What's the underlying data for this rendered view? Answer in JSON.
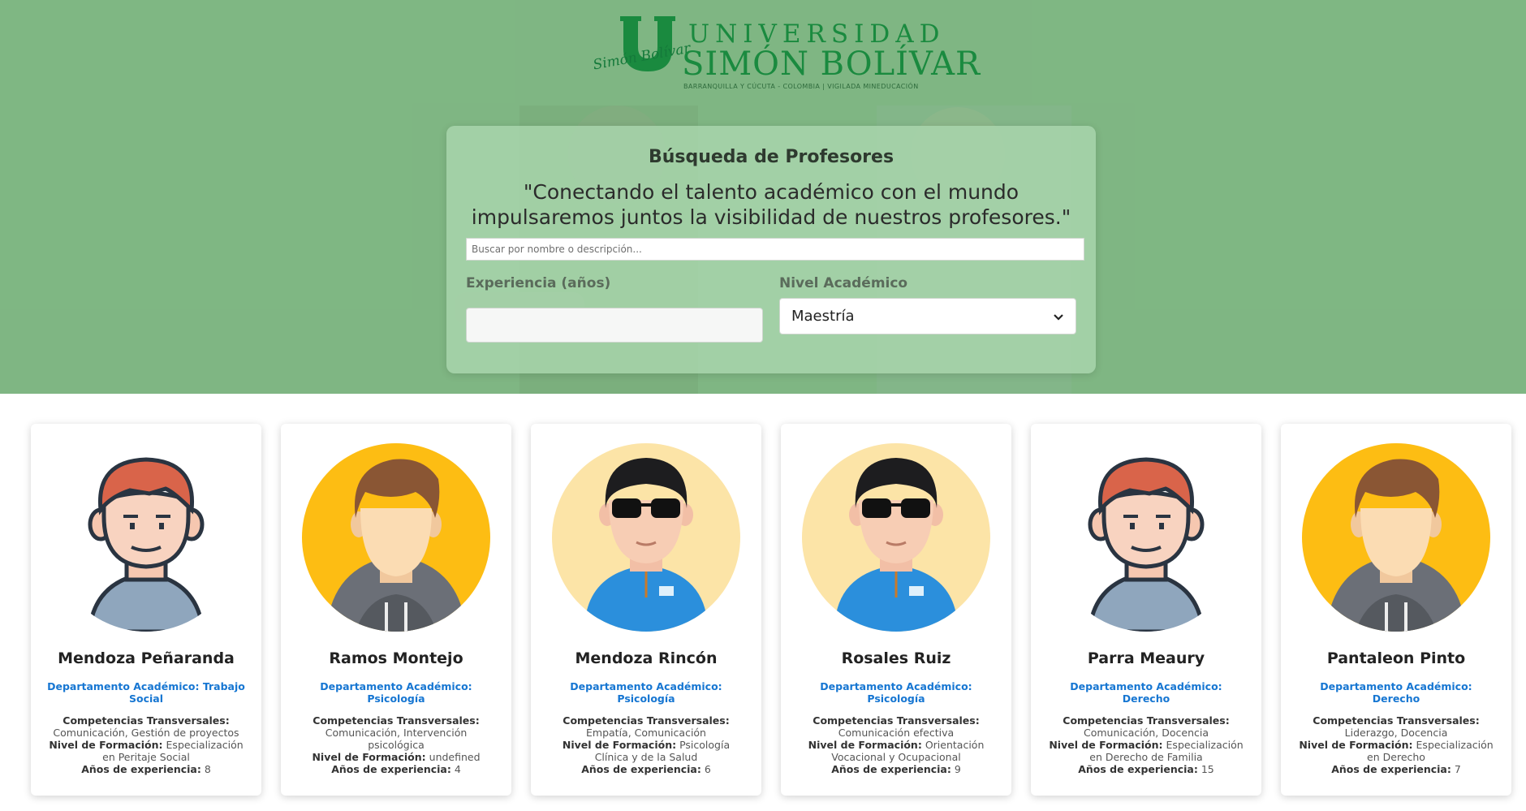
{
  "logo": {
    "top": "UNIVERSIDAD",
    "name": "SIMÓN BOLÍVAR",
    "script": "Simón Bolívar",
    "subtitle": "BARRANQUILLA Y CÚCUTA - COLOMBIA  |  VIGILADA MINEDUCACIÓN"
  },
  "search": {
    "title": "Búsqueda de Profesores",
    "quote": "\"Conectando el talento académico con el mundo impulsaremos juntos la visibilidad de nuestros profesores.\"",
    "placeholder": "Buscar por nombre o descripción...",
    "experience_label": "Experiencia (años)",
    "experience_value": "",
    "level_label": "Nivel Académico",
    "level_value": "Maestría"
  },
  "labels": {
    "competencias": "Competencias Transversales:",
    "nivel": "Nivel de Formación:",
    "anos": "Años de experiencia:"
  },
  "colors": {
    "hero_green": "#7fb783",
    "dept_blue": "#1676d2",
    "logo_green": "#1a8a3f"
  },
  "professors": [
    {
      "name": "Mendoza Peñaranda",
      "department": "Departamento Académico: Trabajo Social",
      "competencias": "Comunicación, Gestión de proyectos",
      "nivel": "Especialización en Peritaje Social",
      "anos": "8",
      "avatar": "redhead-man-avatar"
    },
    {
      "name": "Ramos Montejo",
      "department": "Departamento Académico: Psicología",
      "competencias": "Comunicación, Intervención psicológica",
      "nivel": "undefined",
      "anos": "4",
      "avatar": "hoodie-man-avatar"
    },
    {
      "name": "Mendoza Rincón",
      "department": "Departamento Académico: Psicología",
      "competencias": "Empatía, Comunicación",
      "nivel": "Psicología Clínica y de la Salud",
      "anos": "6",
      "avatar": "sunglasses-man-avatar"
    },
    {
      "name": "Rosales Ruiz",
      "department": "Departamento Académico: Psicología",
      "competencias": "Comunicación efectiva",
      "nivel": "Orientación Vocacional y Ocupacional",
      "anos": "9",
      "avatar": "sunglasses-man-avatar"
    },
    {
      "name": "Parra Meaury",
      "department": "Departamento Académico: Derecho",
      "competencias": "Comunicación, Docencia",
      "nivel": "Especialización en Derecho de Familia",
      "anos": "15",
      "avatar": "redhead-man-avatar"
    },
    {
      "name": "Pantaleon Pinto",
      "department": "Departamento Académico: Derecho",
      "competencias": "Liderazgo, Docencia",
      "nivel": "Especialización en Derecho",
      "anos": "7",
      "avatar": "hoodie-man-avatar"
    }
  ]
}
